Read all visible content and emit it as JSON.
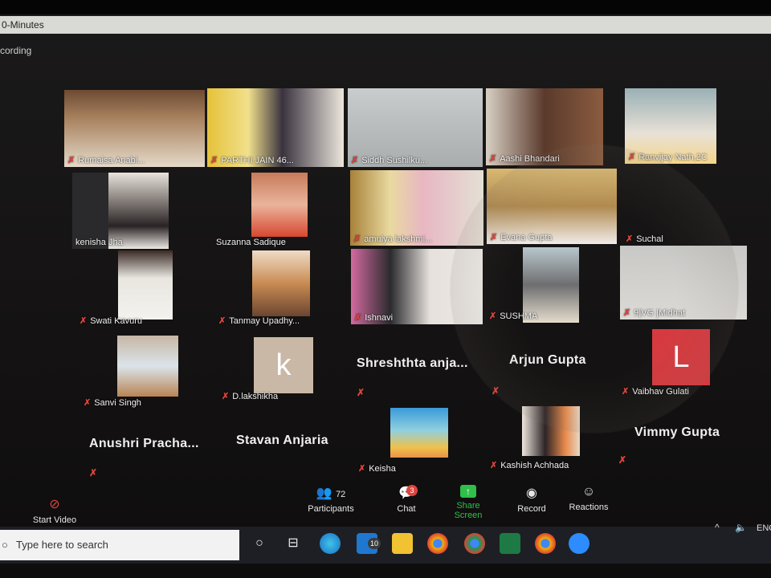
{
  "window": {
    "title": "0-Minutes",
    "recording": "cording"
  },
  "participants_grid": [
    {
      "name": "Rumaisa Anabi..."
    },
    {
      "name": "PARTHI JAIN 46..."
    },
    {
      "name": "Siddh Sushilku..."
    },
    {
      "name": "Aashi Bhandari"
    },
    {
      "name": "Ranvijay Nath,2C"
    },
    {
      "name": "kenisha Jha"
    },
    {
      "name": "Suzanna Sadique"
    },
    {
      "name": "amulya lakshmi..."
    },
    {
      "name": "Evana Gupta"
    },
    {
      "name": "Suchal"
    },
    {
      "name": "Swati Kavuru"
    },
    {
      "name": "Tanmay Upadhy..."
    },
    {
      "name": "Ishnavi"
    },
    {
      "name": "SUSHMA"
    },
    {
      "name": "9|VG |Midhat"
    },
    {
      "name": "Sanvi Singh"
    },
    {
      "name": "D.lakshikha",
      "avatar": "k"
    },
    {
      "name": "Shreshthta anja..."
    },
    {
      "name": "Arjun Gupta"
    },
    {
      "name": "Vaibhav Gulati",
      "avatar": "L"
    },
    {
      "name": "Anushri Pracha..."
    },
    {
      "name": "Stavan Anjaria"
    },
    {
      "name": "Keisha"
    },
    {
      "name": "Kashish Achhada"
    },
    {
      "name": "Vimmy Gupta"
    }
  ],
  "toolbar": {
    "start_video": "Start Video",
    "participants": "Participants",
    "participants_count": "72",
    "chat": "Chat",
    "chat_badge": "3",
    "share_screen": "Share Screen",
    "record": "Record",
    "reactions": "Reactions"
  },
  "taskbar": {
    "search_placeholder": "Type here to search",
    "mail_badge": "10",
    "lang": "ENG"
  },
  "colors": {
    "accent_green": "#2fbf4a",
    "mic_red": "#e0443c",
    "avatar_bg": "#c9b8a6",
    "avatar_red": "#d63a3f"
  },
  "icons": [
    "mic-muted-icon",
    "camera-off-icon",
    "participants-icon",
    "chat-icon",
    "share-screen-icon",
    "record-icon",
    "reactions-icon",
    "windows-search-icon",
    "taskview-icon",
    "edge-icon",
    "mail-icon",
    "file-explorer-icon",
    "chrome-icon",
    "excel-icon",
    "zoom-icon"
  ]
}
